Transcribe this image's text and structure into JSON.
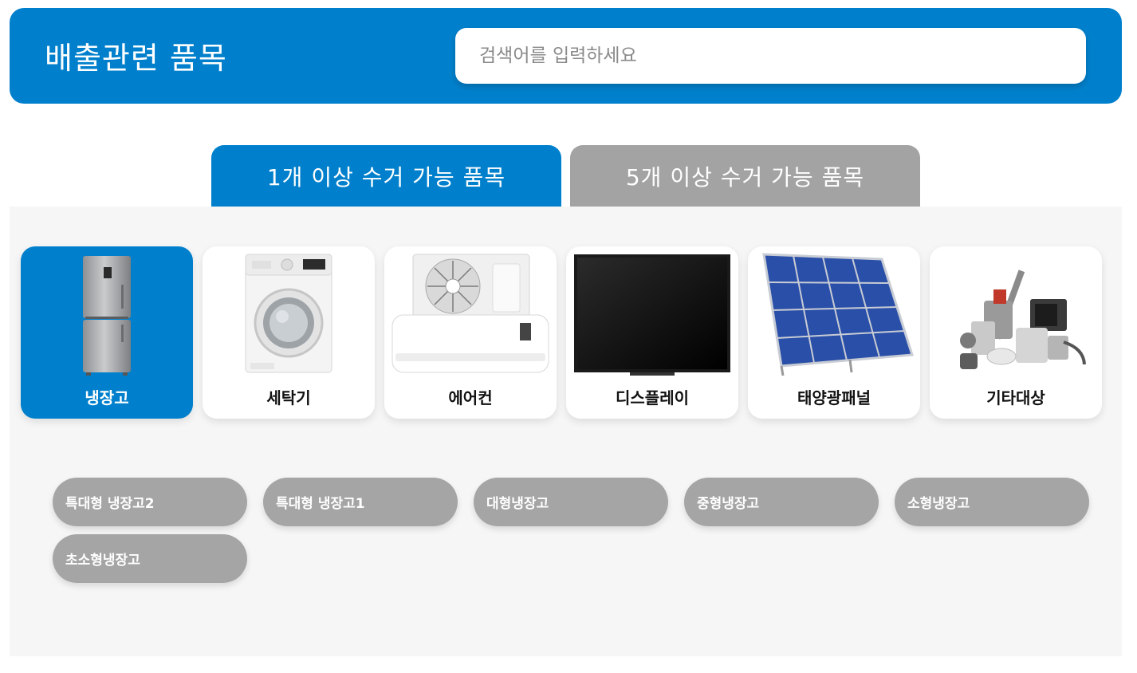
{
  "header": {
    "title": "배출관련 품목",
    "search_placeholder": "검색어를 입력하세요"
  },
  "tabs": [
    {
      "label": "1개 이상 수거 가능 품목",
      "active": true
    },
    {
      "label": "5개 이상 수거 가능 품목",
      "active": false
    }
  ],
  "categories": [
    {
      "label": "냉장고",
      "icon": "refrigerator-icon",
      "active": true
    },
    {
      "label": "세탁기",
      "icon": "washing-machine-icon",
      "active": false
    },
    {
      "label": "에어컨",
      "icon": "air-conditioner-icon",
      "active": false
    },
    {
      "label": "디스플레이",
      "icon": "display-icon",
      "active": false
    },
    {
      "label": "태양광패널",
      "icon": "solar-panel-icon",
      "active": false
    },
    {
      "label": "기타대상",
      "icon": "misc-appliances-icon",
      "active": false
    }
  ],
  "subitems": [
    {
      "label": "특대형 냉장고2"
    },
    {
      "label": "특대형 냉장고1"
    },
    {
      "label": "대형냉장고"
    },
    {
      "label": "중형냉장고"
    },
    {
      "label": "소형냉장고"
    },
    {
      "label": "초소형냉장고"
    }
  ],
  "colors": {
    "primary": "#0080cc",
    "inactive": "#a3a3a3",
    "panel_bg": "#f6f6f6"
  }
}
